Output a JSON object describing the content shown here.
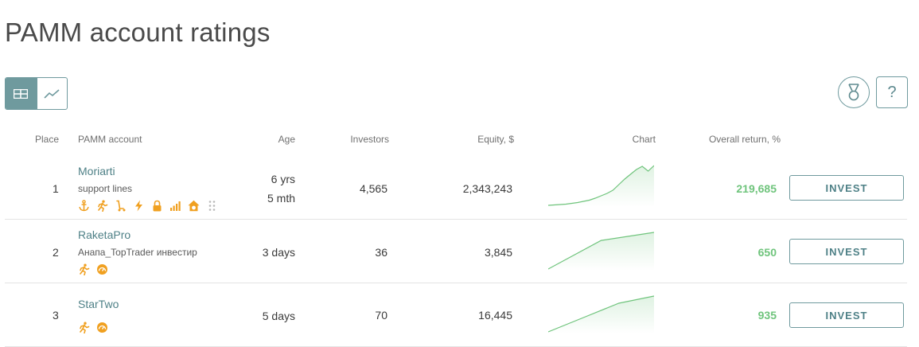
{
  "page": {
    "title": "PAMM account ratings"
  },
  "toolbar": {
    "view_table_icon": "table-icon",
    "view_chart_icon": "line-chart-icon",
    "medal_icon": "medal-icon",
    "help_label": "?"
  },
  "columns": {
    "place": "Place",
    "account": "PAMM account",
    "age": "Age",
    "investors": "Investors",
    "equity": "Equity, $",
    "chart": "Chart",
    "return": "Overall return, %"
  },
  "colors": {
    "accent": "#6f9a9e",
    "link": "#4f8187",
    "positive": "#6fc47c",
    "badge": "#f0a020"
  },
  "rows": [
    {
      "place": "1",
      "name": "Moriarti",
      "subtitle": "support lines",
      "age_line1": "6 yrs",
      "age_line2": "5 mth",
      "investors": "4,565",
      "equity": "2,343,243",
      "return": "219,685",
      "invest_label": "INVEST",
      "badges": [
        "anchor-icon",
        "runner-icon",
        "scooter-icon",
        "lightning-icon",
        "lock-icon",
        "signal-icon",
        "home-dollar-icon",
        "more-icon"
      ],
      "spark": [
        0.0,
        0.01,
        0.02,
        0.03,
        0.05,
        0.07,
        0.1,
        0.13,
        0.18,
        0.24,
        0.3,
        0.38,
        0.52,
        0.66,
        0.78,
        0.9,
        0.98,
        0.86,
        1.0
      ]
    },
    {
      "place": "2",
      "name": "RaketaPro",
      "subtitle": "Анапа_TopTrader инвестир",
      "age_line1": "3 days",
      "age_line2": "",
      "investors": "36",
      "equity": "3,845",
      "return": "650",
      "invest_label": "INVEST",
      "badges": [
        "runner-icon",
        "speedometer-icon"
      ],
      "spark": [
        0.0,
        0.78,
        1.0
      ]
    },
    {
      "place": "3",
      "name": "StarTwo",
      "subtitle": "",
      "age_line1": "5 days",
      "age_line2": "",
      "investors": "70",
      "equity": "16,445",
      "return": "935",
      "invest_label": "INVEST",
      "badges": [
        "runner-icon",
        "speedometer-icon"
      ],
      "spark": [
        0.0,
        0.4,
        0.8,
        1.0
      ]
    }
  ]
}
